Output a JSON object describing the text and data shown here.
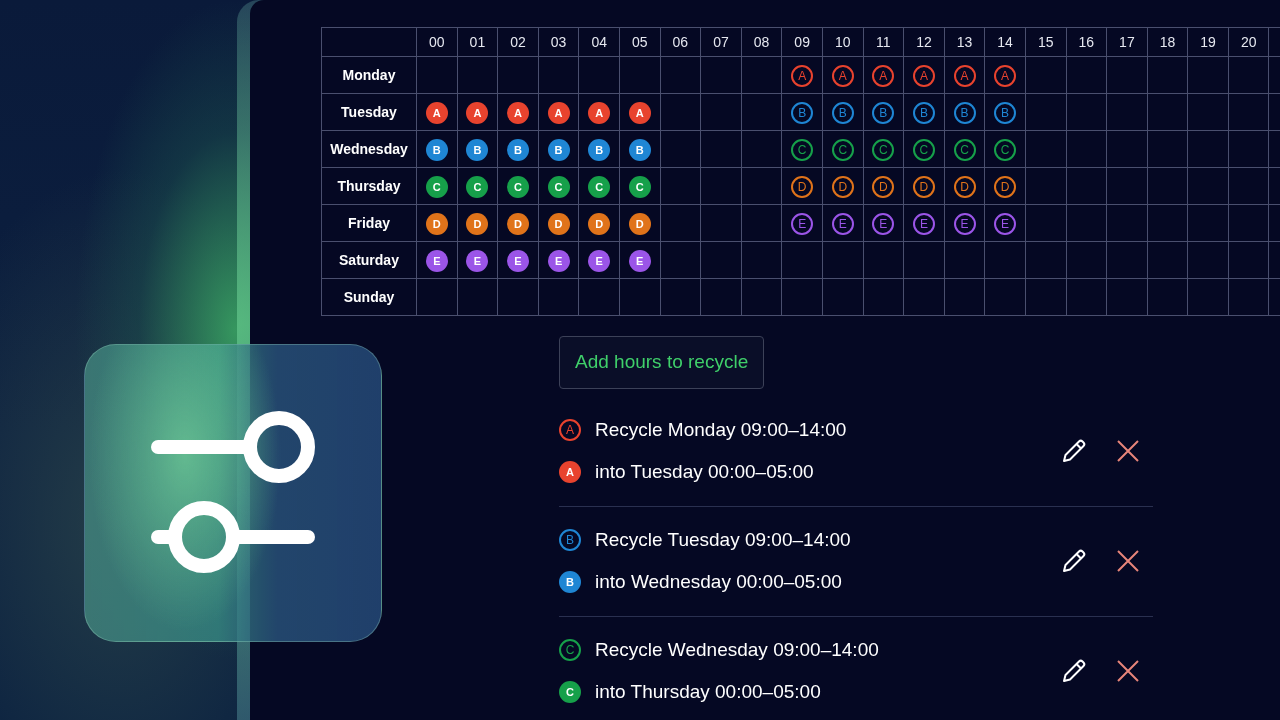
{
  "schedule": {
    "columns": [
      "00",
      "01",
      "02",
      "03",
      "04",
      "05",
      "06",
      "07",
      "08",
      "09",
      "10",
      "11",
      "12",
      "13",
      "14",
      "15",
      "16",
      "17",
      "18",
      "19",
      "20"
    ],
    "rows": [
      {
        "day": "Monday",
        "cells": [
          null,
          null,
          null,
          null,
          null,
          null,
          null,
          null,
          null,
          {
            "label": "A",
            "color": "#e8432e",
            "kind": "outline"
          },
          {
            "label": "A",
            "color": "#e8432e",
            "kind": "outline"
          },
          {
            "label": "A",
            "color": "#e8432e",
            "kind": "outline"
          },
          {
            "label": "A",
            "color": "#e8432e",
            "kind": "outline"
          },
          {
            "label": "A",
            "color": "#e8432e",
            "kind": "outline"
          },
          {
            "label": "A",
            "color": "#e8432e",
            "kind": "outline"
          },
          null,
          null,
          null,
          null,
          null,
          null
        ]
      },
      {
        "day": "Tuesday",
        "cells": [
          {
            "label": "A",
            "color": "#e8432e",
            "kind": "solid"
          },
          {
            "label": "A",
            "color": "#e8432e",
            "kind": "solid"
          },
          {
            "label": "A",
            "color": "#e8432e",
            "kind": "solid"
          },
          {
            "label": "A",
            "color": "#e8432e",
            "kind": "solid"
          },
          {
            "label": "A",
            "color": "#e8432e",
            "kind": "solid"
          },
          {
            "label": "A",
            "color": "#e8432e",
            "kind": "solid"
          },
          null,
          null,
          null,
          {
            "label": "B",
            "color": "#1f86d4",
            "kind": "outline"
          },
          {
            "label": "B",
            "color": "#1f86d4",
            "kind": "outline"
          },
          {
            "label": "B",
            "color": "#1f86d4",
            "kind": "outline"
          },
          {
            "label": "B",
            "color": "#1f86d4",
            "kind": "outline"
          },
          {
            "label": "B",
            "color": "#1f86d4",
            "kind": "outline"
          },
          {
            "label": "B",
            "color": "#1f86d4",
            "kind": "outline"
          },
          null,
          null,
          null,
          null,
          null,
          null
        ]
      },
      {
        "day": "Wednesday",
        "cells": [
          {
            "label": "B",
            "color": "#1f86d4",
            "kind": "solid"
          },
          {
            "label": "B",
            "color": "#1f86d4",
            "kind": "solid"
          },
          {
            "label": "B",
            "color": "#1f86d4",
            "kind": "solid"
          },
          {
            "label": "B",
            "color": "#1f86d4",
            "kind": "solid"
          },
          {
            "label": "B",
            "color": "#1f86d4",
            "kind": "solid"
          },
          {
            "label": "B",
            "color": "#1f86d4",
            "kind": "solid"
          },
          null,
          null,
          null,
          {
            "label": "C",
            "color": "#16a04a",
            "kind": "outline"
          },
          {
            "label": "C",
            "color": "#16a04a",
            "kind": "outline"
          },
          {
            "label": "C",
            "color": "#16a04a",
            "kind": "outline"
          },
          {
            "label": "C",
            "color": "#16a04a",
            "kind": "outline"
          },
          {
            "label": "C",
            "color": "#16a04a",
            "kind": "outline"
          },
          {
            "label": "C",
            "color": "#16a04a",
            "kind": "outline"
          },
          null,
          null,
          null,
          null,
          null,
          null
        ]
      },
      {
        "day": "Thursday",
        "cells": [
          {
            "label": "C",
            "color": "#16a04a",
            "kind": "solid"
          },
          {
            "label": "C",
            "color": "#16a04a",
            "kind": "solid"
          },
          {
            "label": "C",
            "color": "#16a04a",
            "kind": "solid"
          },
          {
            "label": "C",
            "color": "#16a04a",
            "kind": "solid"
          },
          {
            "label": "C",
            "color": "#16a04a",
            "kind": "solid"
          },
          {
            "label": "C",
            "color": "#16a04a",
            "kind": "solid"
          },
          null,
          null,
          null,
          {
            "label": "D",
            "color": "#e0731a",
            "kind": "outline"
          },
          {
            "label": "D",
            "color": "#e0731a",
            "kind": "outline"
          },
          {
            "label": "D",
            "color": "#e0731a",
            "kind": "outline"
          },
          {
            "label": "D",
            "color": "#e0731a",
            "kind": "outline"
          },
          {
            "label": "D",
            "color": "#e0731a",
            "kind": "outline"
          },
          {
            "label": "D",
            "color": "#e0731a",
            "kind": "outline"
          },
          null,
          null,
          null,
          null,
          null,
          null
        ]
      },
      {
        "day": "Friday",
        "cells": [
          {
            "label": "D",
            "color": "#e0731a",
            "kind": "solid"
          },
          {
            "label": "D",
            "color": "#e0731a",
            "kind": "solid"
          },
          {
            "label": "D",
            "color": "#e0731a",
            "kind": "solid"
          },
          {
            "label": "D",
            "color": "#e0731a",
            "kind": "solid"
          },
          {
            "label": "D",
            "color": "#e0731a",
            "kind": "solid"
          },
          {
            "label": "D",
            "color": "#e0731a",
            "kind": "solid"
          },
          null,
          null,
          null,
          {
            "label": "E",
            "color": "#9b55e8",
            "kind": "outline"
          },
          {
            "label": "E",
            "color": "#9b55e8",
            "kind": "outline"
          },
          {
            "label": "E",
            "color": "#9b55e8",
            "kind": "outline"
          },
          {
            "label": "E",
            "color": "#9b55e8",
            "kind": "outline"
          },
          {
            "label": "E",
            "color": "#9b55e8",
            "kind": "outline"
          },
          {
            "label": "E",
            "color": "#9b55e8",
            "kind": "outline"
          },
          null,
          null,
          null,
          null,
          null,
          null
        ]
      },
      {
        "day": "Saturday",
        "cells": [
          {
            "label": "E",
            "color": "#9b55e8",
            "kind": "solid"
          },
          {
            "label": "E",
            "color": "#9b55e8",
            "kind": "solid"
          },
          {
            "label": "E",
            "color": "#9b55e8",
            "kind": "solid"
          },
          {
            "label": "E",
            "color": "#9b55e8",
            "kind": "solid"
          },
          {
            "label": "E",
            "color": "#9b55e8",
            "kind": "solid"
          },
          {
            "label": "E",
            "color": "#9b55e8",
            "kind": "solid"
          },
          null,
          null,
          null,
          null,
          null,
          null,
          null,
          null,
          null,
          null,
          null,
          null,
          null,
          null,
          null
        ]
      },
      {
        "day": "Sunday",
        "cells": [
          null,
          null,
          null,
          null,
          null,
          null,
          null,
          null,
          null,
          null,
          null,
          null,
          null,
          null,
          null,
          null,
          null,
          null,
          null,
          null,
          null
        ]
      }
    ]
  },
  "add_button": "Add hours to recycle",
  "rules": [
    {
      "color": "#e8432e",
      "from_badge": "A",
      "from": "Recycle Monday 09:00–14:00",
      "into_badge": "A",
      "into": "into Tuesday 00:00–05:00"
    },
    {
      "color": "#1f86d4",
      "from_badge": "B",
      "from": "Recycle Tuesday 09:00–14:00",
      "into_badge": "B",
      "into": "into Wednesday 00:00–05:00"
    },
    {
      "color": "#16a04a",
      "from_badge": "C",
      "from": "Recycle Wednesday 09:00–14:00",
      "into_badge": "C",
      "into": "into Thursday 00:00–05:00"
    }
  ]
}
